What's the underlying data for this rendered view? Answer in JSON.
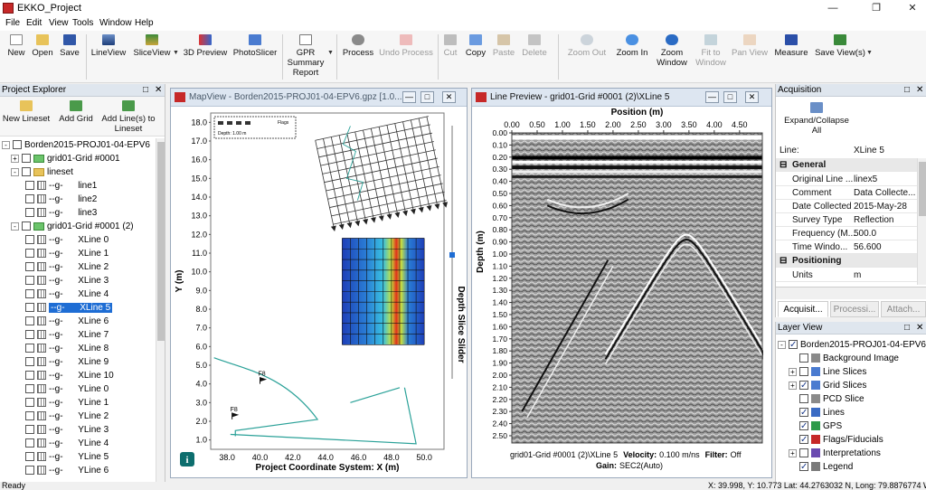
{
  "window": {
    "title": "EKKO_Project"
  },
  "menu": [
    "File",
    "Edit",
    "View",
    "Tools",
    "Window",
    "Help"
  ],
  "ribbon": {
    "buttons": [
      {
        "label": "New",
        "disabled": false
      },
      {
        "label": "Open",
        "disabled": false
      },
      {
        "label": "Save",
        "disabled": false
      },
      {
        "label": "LineView",
        "disabled": false
      },
      {
        "label": "SliceView",
        "disabled": false
      },
      {
        "label": "3D Preview",
        "disabled": false
      },
      {
        "label": "PhotoSlicer",
        "disabled": false
      },
      {
        "label": "GPR Summary Report",
        "disabled": false
      },
      {
        "label": "Process",
        "disabled": false
      },
      {
        "label": "Undo Process",
        "disabled": true
      },
      {
        "label": "Cut",
        "disabled": true
      },
      {
        "label": "Copy",
        "disabled": false
      },
      {
        "label": "Paste",
        "disabled": true
      },
      {
        "label": "Delete",
        "disabled": true
      },
      {
        "label": "Zoom Out",
        "disabled": true
      },
      {
        "label": "Zoom In",
        "disabled": false
      },
      {
        "label": "Zoom Window",
        "disabled": false
      },
      {
        "label": "Fit to Window",
        "disabled": true
      },
      {
        "label": "Pan View",
        "disabled": true
      },
      {
        "label": "Measure",
        "disabled": false
      },
      {
        "label": "Save View(s)",
        "disabled": false
      }
    ]
  },
  "project_explorer": {
    "title": "Project Explorer",
    "toolbar": [
      "New Lineset",
      "Add Grid",
      "Add Line(s) to Lineset"
    ],
    "root": "Borden2015-PROJ01-04-EPV6",
    "grid1": "grid01-Grid #0001",
    "lineset": "lineset",
    "lineset_lines": [
      "line1",
      "line2",
      "line3"
    ],
    "grid2": "grid01-Grid #0001 (2)",
    "line_tag": "--g-",
    "grid_lines": [
      "XLine 0",
      "XLine 1",
      "XLine 2",
      "XLine 3",
      "XLine 4",
      "XLine 5",
      "XLine 6",
      "XLine 7",
      "XLine 8",
      "XLine 9",
      "XLine 10",
      "YLine 0",
      "YLine 1",
      "YLine 2",
      "YLine 3",
      "YLine 4",
      "YLine 5",
      "YLine 6"
    ],
    "selected": "XLine 5"
  },
  "map_view": {
    "title": "MapView - Borden2015-PROJ01-04-EPV6.gpz [1.0...",
    "xlabel": "Project Coordinate System: X (m)",
    "ylabel": "Y (m)",
    "xticks": [
      "38.0",
      "40.0",
      "42.0",
      "44.0",
      "46.0",
      "48.0",
      "50.0"
    ],
    "yticks": [
      "18.0",
      "17.0",
      "16.0",
      "15.0",
      "14.0",
      "13.0",
      "12.0",
      "11.0",
      "10.0",
      "9.0",
      "8.0",
      "7.0",
      "6.0",
      "5.0",
      "4.0",
      "3.0",
      "2.0",
      "1.0"
    ],
    "slider_label": "Depth Slice Slider",
    "flag_labels": [
      "F8",
      "F8"
    ],
    "legend_text": "Flags",
    "depth_text": "Depth: 1.00 m"
  },
  "line_preview": {
    "title": "Line Preview - grid01-Grid #0001 (2)\\XLine 5",
    "xlabel": "Position (m)",
    "ylabel": "Depth (m)",
    "xticks": [
      "0.00",
      "0.50",
      "1.00",
      "1.50",
      "2.00",
      "2.50",
      "3.00",
      "3.50",
      "4.00",
      "4.50"
    ],
    "yticks": [
      "0.00",
      "0.10",
      "0.20",
      "0.30",
      "0.40",
      "0.50",
      "0.60",
      "0.70",
      "0.80",
      "0.90",
      "1.00",
      "1.10",
      "1.20",
      "1.30",
      "1.40",
      "1.50",
      "1.60",
      "1.70",
      "1.80",
      "1.90",
      "2.00",
      "2.10",
      "2.20",
      "2.30",
      "2.40",
      "2.50"
    ],
    "footer1_line": "grid01-Grid #0001 (2)\\XLine 5",
    "footer1_vel_label": "Velocity:",
    "footer1_vel": "0.100 m/ns",
    "footer1_filter_label": "Filter:",
    "footer1_filter": "Off",
    "footer2_gain_label": "Gain:",
    "footer2_gain": "SEC2(Auto)"
  },
  "acquisition": {
    "title": "Acquisition",
    "expand_label": "Expand/Collapse All",
    "line_key": "Line:",
    "line_value": "XLine 5",
    "general": "General",
    "props": [
      {
        "k": "Original Line ...",
        "v": "linex5"
      },
      {
        "k": "Comment",
        "v": "Data Collecte..."
      },
      {
        "k": "Date Collected",
        "v": "2015-May-28"
      },
      {
        "k": "Survey Type",
        "v": "Reflection"
      },
      {
        "k": "Frequency (M...",
        "v": "500.0"
      },
      {
        "k": "Time Windo...",
        "v": "56.600"
      }
    ],
    "positioning": "Positioning",
    "units_k": "Units",
    "units_v": "m",
    "tabs": [
      "Acquisit...",
      "Processi...",
      "Attach..."
    ]
  },
  "layer_view": {
    "title": "Layer View",
    "root": "Borden2015-PROJ01-04-EPV6",
    "items": [
      {
        "label": "Background Image",
        "checked": false
      },
      {
        "label": "Line Slices",
        "checked": false
      },
      {
        "label": "Grid Slices",
        "checked": true
      },
      {
        "label": "PCD Slice",
        "checked": false
      },
      {
        "label": "Lines",
        "checked": true
      },
      {
        "label": "GPS",
        "checked": true
      },
      {
        "label": "Flags/Fiducials",
        "checked": true
      },
      {
        "label": "Interpretations",
        "checked": false
      },
      {
        "label": "Legend",
        "checked": true
      }
    ]
  },
  "status": {
    "left": "Ready",
    "right": "X: 39.998, Y: 10.773 Lat: 44.2763032 N, Long: 79.8876774 W"
  }
}
